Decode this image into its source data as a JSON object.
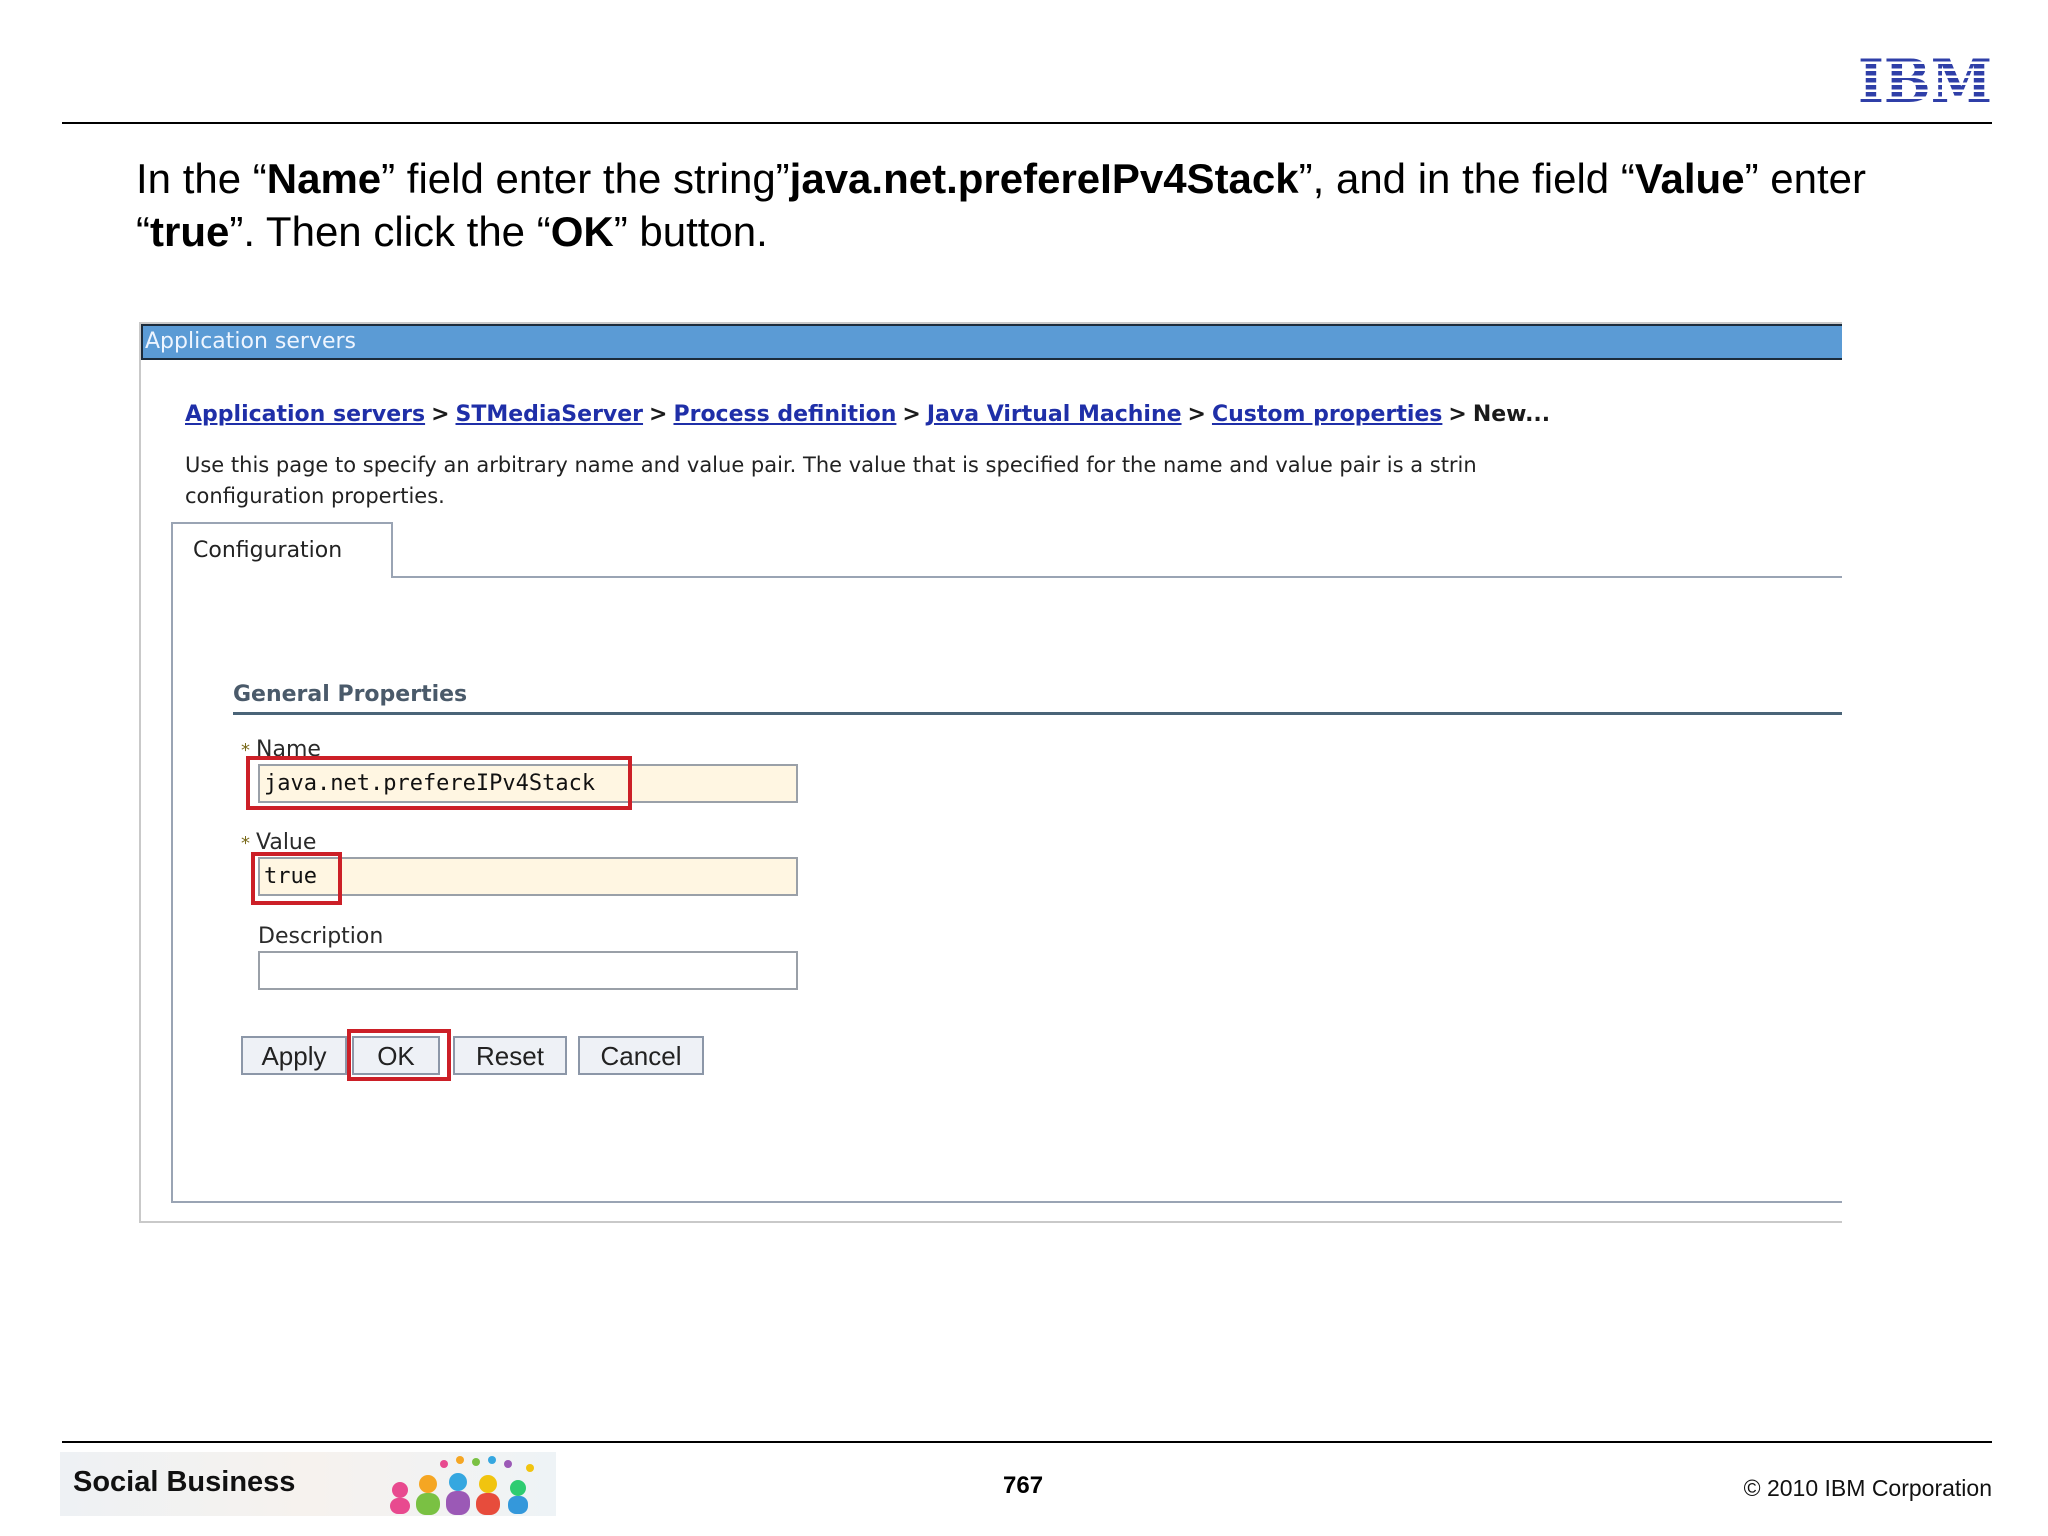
{
  "slide": {
    "logo_text": "IBM",
    "instruction": {
      "p1": "In the “",
      "b1": "Name",
      "p2": "” field enter the string”",
      "b2": "java.net.prefereIPv4Stack",
      "p3": "”, and in the field “",
      "b3": "Value",
      "p4": "” enter “",
      "b4": "true",
      "p5": "”. Then click the “",
      "b5": "OK",
      "p6": "” button."
    },
    "footer": {
      "brand": "Social Business",
      "page_number": "767",
      "copyright": "© 2010 IBM Corporation"
    }
  },
  "screenshot": {
    "title_bar": "Application servers",
    "breadcrumb": {
      "items": [
        "Application servers",
        "STMediaServer",
        "Process definition",
        "Java Virtual Machine",
        "Custom properties"
      ],
      "separator": ">",
      "current": "New..."
    },
    "description_line1": "Use this page to specify an arbitrary name and value pair. The value that is specified for the name and value pair is a strin",
    "description_line2": "configuration properties.",
    "tab_label": "Configuration",
    "section_title": "General Properties",
    "required_marker": "*",
    "fields": {
      "name_label": "Name",
      "name_value": "java.net.prefereIPv4Stack",
      "value_label": "Value",
      "value_value": "true",
      "description_label": "Description",
      "description_value": ""
    },
    "buttons": {
      "apply": "Apply",
      "ok": "OK",
      "reset": "Reset",
      "cancel": "Cancel"
    },
    "highlight_color": "#cc1f27"
  },
  "colors": {
    "title_bar": "#5b9bd5",
    "link": "#1f2fa8",
    "required_field_bg": "#fff6e2"
  }
}
